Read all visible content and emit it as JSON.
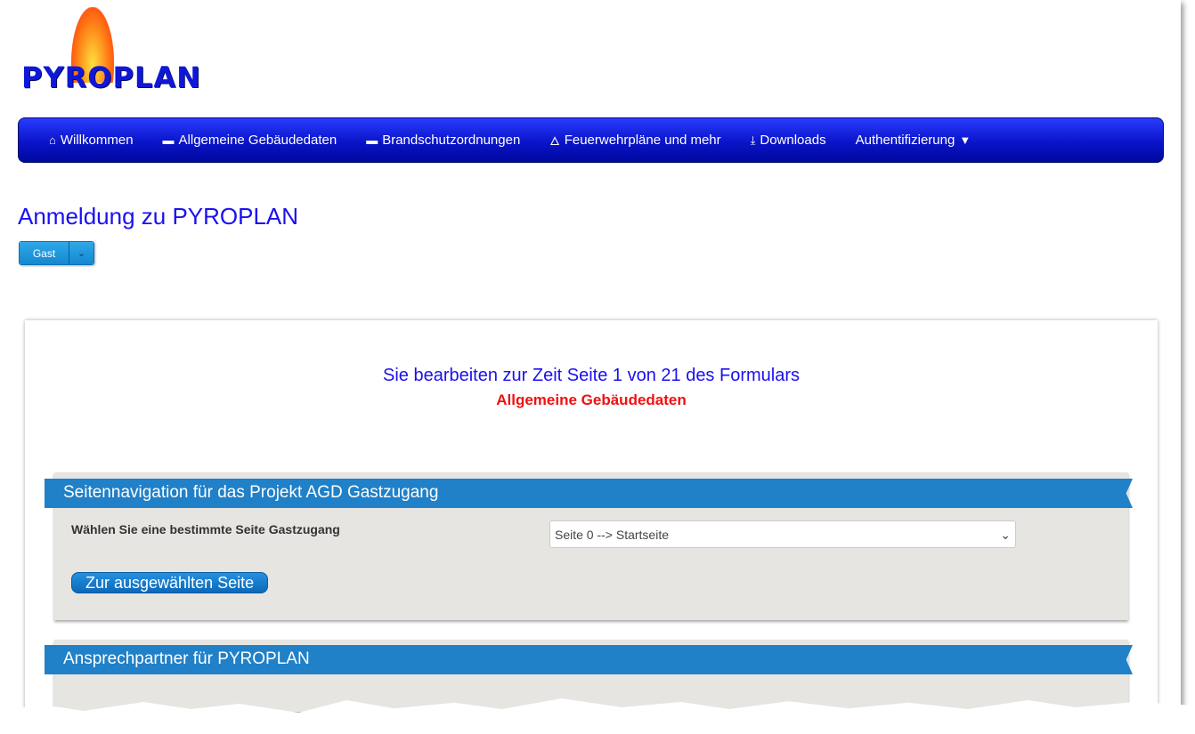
{
  "logo": {
    "text": "PYROPLAN"
  },
  "nav": {
    "items": [
      {
        "icon": "home-icon",
        "glyph": "⌂",
        "label": "Willkommen"
      },
      {
        "icon": "archive-icon",
        "glyph": "▬",
        "label": "Allgemeine Gebäudedaten"
      },
      {
        "icon": "archive-icon",
        "glyph": "▬",
        "label": "Brandschutzordnungen"
      },
      {
        "icon": "fire-icon",
        "glyph": "🜂",
        "label": "Feuerwehrpläne und mehr"
      },
      {
        "icon": "download-icon",
        "glyph": "⤓",
        "label": "Downloads"
      },
      {
        "icon": "caret-down-icon",
        "glyph": "▼",
        "label": "Authentifizierung"
      }
    ]
  },
  "page_title": "Anmeldung zu PYROPLAN",
  "user_button": {
    "label": "Gast",
    "caret": "⌄"
  },
  "status": {
    "line1": "Sie bearbeiten zur Zeit Seite 1 von 21 des Formulars",
    "line2": "Allgemeine Gebäudedaten"
  },
  "colors": {
    "nav": "#1020e0",
    "title": "#1a10f0",
    "section": "#2080c8",
    "warning": "#f01010"
  },
  "section1": {
    "title": "Seitennavigation für das Projekt AGD Gastzugang",
    "label": "Wählen Sie eine bestimmte Seite Gastzugang",
    "select_value": "Seite 0 --> Startseite",
    "button": "Zur ausgewählten Seite"
  },
  "section2": {
    "title": "Ansprechpartner für PYROPLAN"
  }
}
